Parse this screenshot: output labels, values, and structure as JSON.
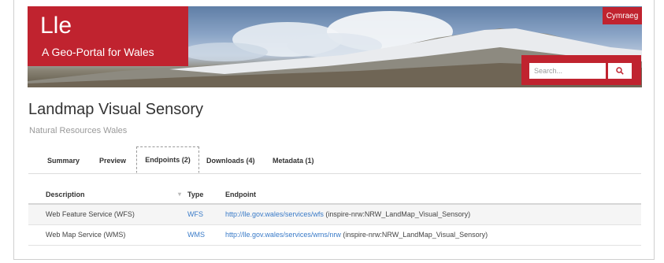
{
  "site": {
    "title": "Lle",
    "subtitle": "A Geo-Portal for Wales",
    "language_button": "Cymraeg",
    "search": {
      "placeholder": "Search..."
    }
  },
  "dataset": {
    "title": "Landmap Visual Sensory",
    "publisher": "Natural Resources Wales"
  },
  "tabs": [
    {
      "label": "Summary"
    },
    {
      "label": "Preview"
    },
    {
      "label": "Endpoints (2)",
      "active": true
    },
    {
      "label": "Downloads (4)"
    },
    {
      "label": "Metadata (1)"
    }
  ],
  "table": {
    "headers": [
      "Description",
      "Type",
      "Endpoint"
    ],
    "rows": [
      {
        "description": "Web Feature Service (WFS)",
        "type": "WFS",
        "url": "http://lle.gov.wales/services/wfs",
        "layer": "(inspire-nrw:NRW_LandMap_Visual_Sensory)"
      },
      {
        "description": "Web Map Service (WMS)",
        "type": "WMS",
        "url": "http://lle.gov.wales/services/wms/nrw",
        "layer": "(inspire-nrw:NRW_LandMap_Visual_Sensory)"
      }
    ]
  },
  "colors": {
    "brand": "#c0232f",
    "link": "#3a7bc8"
  },
  "icons": {
    "search": "search-icon",
    "sort": "sort-icon"
  }
}
